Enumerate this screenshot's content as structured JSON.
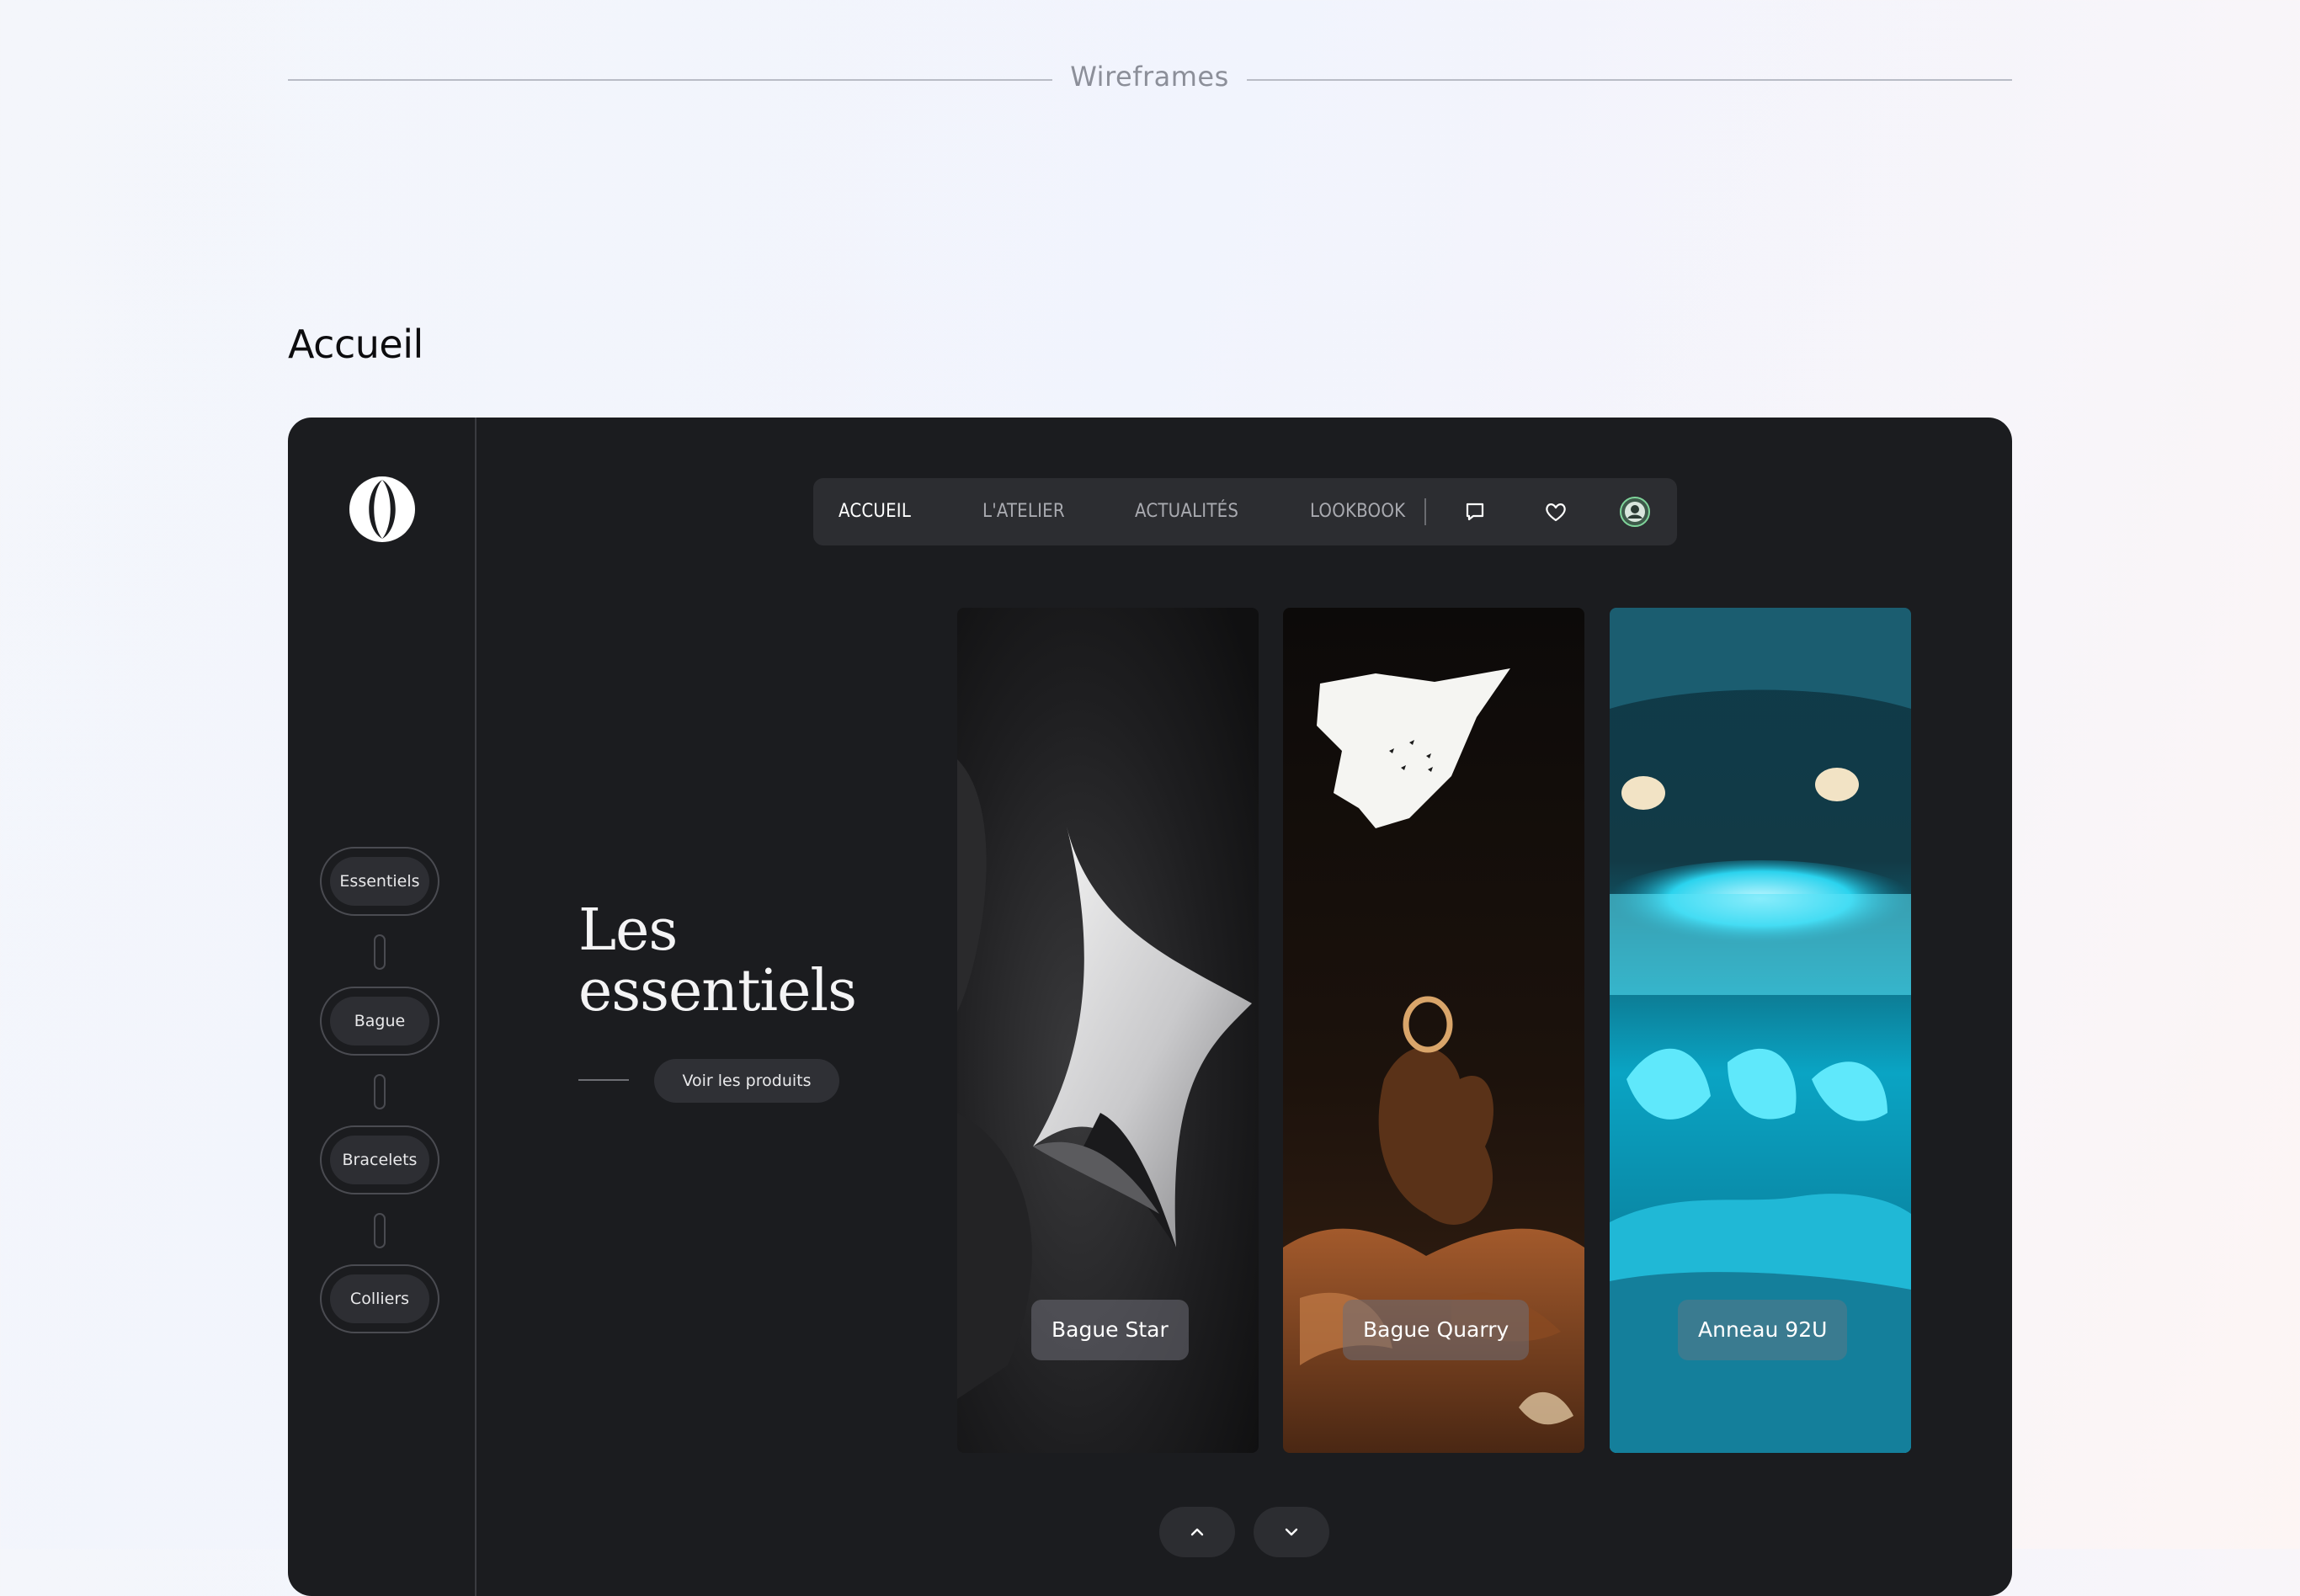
{
  "section": {
    "label": "Wireframes"
  },
  "page": {
    "title": "Accueil"
  },
  "sidebar": {
    "categories": [
      {
        "label": "Essentiels"
      },
      {
        "label": "Bague"
      },
      {
        "label": "Bracelets"
      },
      {
        "label": "Colliers"
      }
    ]
  },
  "nav": {
    "items": [
      {
        "label": "ACCUEIL",
        "active": true
      },
      {
        "label": "L'ATELIER"
      },
      {
        "label": "ACTUALITÉS"
      },
      {
        "label": "LOOKBOOK"
      }
    ],
    "icons": [
      "chat-icon",
      "heart-icon",
      "avatar-icon"
    ]
  },
  "hero": {
    "title_line1": "Les",
    "title_line2": "essentiels",
    "button_label": "Voir les produits"
  },
  "products": [
    {
      "label": "Bague Star"
    },
    {
      "label": "Bague Quarry"
    },
    {
      "label": "Anneau 92U"
    }
  ],
  "pager": {
    "icons": [
      "chevron-up-icon",
      "chevron-down-icon"
    ]
  },
  "colors": {
    "frame_bg": "#1b1c1f",
    "nav_bg": "#2c2d31",
    "accent_teal": "#1fc4e0"
  }
}
